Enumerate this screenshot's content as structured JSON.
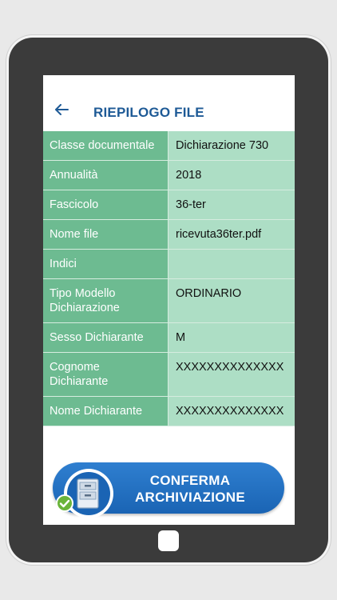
{
  "appbar": {
    "title": "RIEPILOGO FILE"
  },
  "rows": [
    {
      "label": "Classe documentale",
      "value": "Dichiarazione 730"
    },
    {
      "label": "Annualità",
      "value": "2018"
    },
    {
      "label": "Fascicolo",
      "value": "36-ter"
    },
    {
      "label": "Nome file",
      "value": "ricevuta36ter.pdf"
    },
    {
      "label": "Indici",
      "value": ""
    },
    {
      "label": "Tipo Modello Dichiarazione",
      "value": "ORDINARIO"
    },
    {
      "label": "Sesso Dichiarante",
      "value": "M"
    },
    {
      "label": "Cognome Dichiarante",
      "value": "XXXXXXXXXXXXXX"
    },
    {
      "label": "Nome Dichiarante",
      "value": "XXXXXXXXXXXXXX"
    }
  ],
  "confirm": {
    "line1": "CONFERMA",
    "line2": "ARCHIVIAZIONE"
  },
  "colors": {
    "accent": "#1e5a96",
    "label_bg": "#6dbb91",
    "value_bg": "#addec5",
    "button": "#1a64b4"
  },
  "icons": {
    "back": "arrow-left-icon",
    "cabinet": "file-cabinet-icon",
    "check": "check-circle-icon"
  }
}
